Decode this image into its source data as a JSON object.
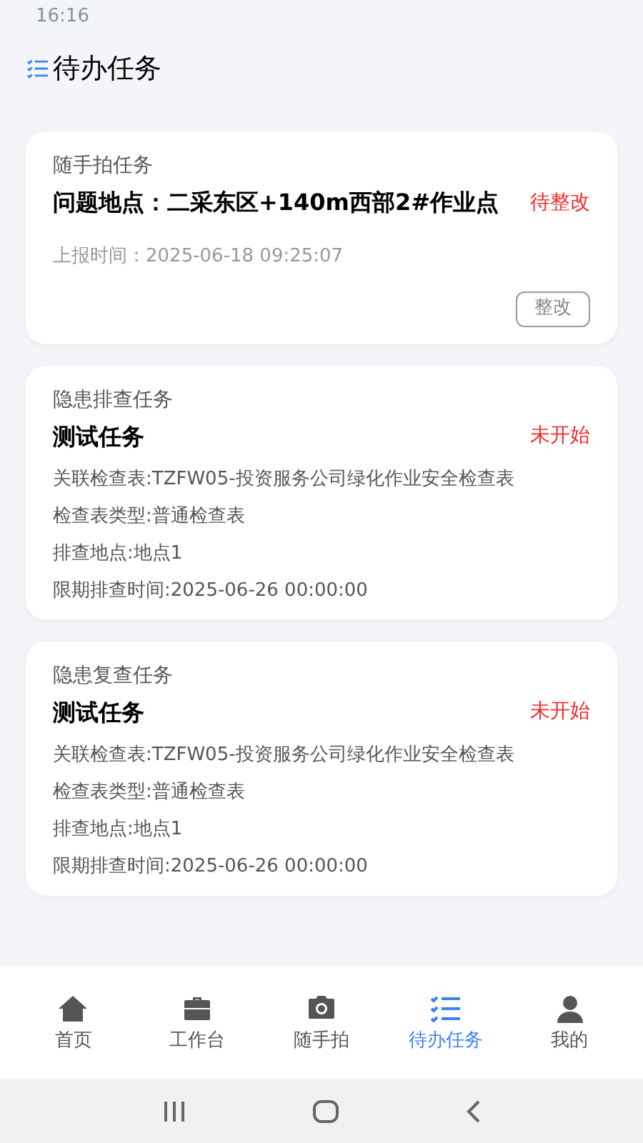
{
  "status_bar": {
    "time": "16:16"
  },
  "header": {
    "title": "待办任务"
  },
  "tasks": [
    {
      "kind": "photo",
      "category": "随手拍任务",
      "title": "问题地点：二采东区+140m西部2#作业点",
      "status": "待整改",
      "details": [
        "上报时间：2025-06-18 09:25:07"
      ],
      "action": "整改"
    },
    {
      "kind": "inspection",
      "category": "隐患排查任务",
      "title": "测试任务",
      "status": "未开始",
      "details": [
        "关联检查表:TZFW05-投资服务公司绿化作业安全检查表",
        "检查表类型:普通检查表",
        "排查地点:地点1",
        "限期排查时间:2025-06-26 00:00:00"
      ]
    },
    {
      "kind": "inspection",
      "category": "隐患复查任务",
      "title": "测试任务",
      "status": "未开始",
      "details": [
        "关联检查表:TZFW05-投资服务公司绿化作业安全检查表",
        "检查表类型:普通检查表",
        "排查地点:地点1",
        "限期排查时间:2025-06-26 00:00:00"
      ]
    }
  ],
  "tab_bar": [
    {
      "kind": "home",
      "label": "首页",
      "selected": false
    },
    {
      "kind": "briefcase",
      "label": "工作台",
      "selected": false
    },
    {
      "kind": "camera",
      "label": "随手拍",
      "selected": false
    },
    {
      "kind": "list",
      "label": "待办任务",
      "selected": true
    },
    {
      "kind": "user",
      "label": "我的",
      "selected": false
    }
  ]
}
